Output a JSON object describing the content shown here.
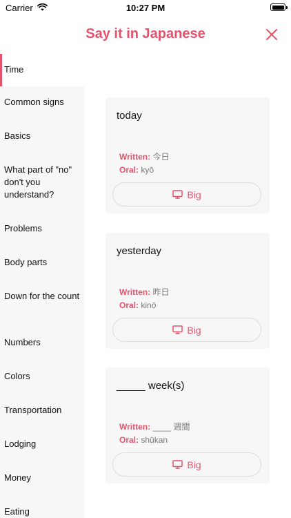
{
  "status_bar": {
    "carrier": "Carrier",
    "time": "10:27 PM"
  },
  "header": {
    "title": "Say it in Japanese"
  },
  "colors": {
    "accent": "#e4536c",
    "sidebar_bg": "#f7f7f7",
    "card_bg": "#f7f7f7"
  },
  "sidebar": {
    "items": [
      {
        "label": "Time",
        "active": true
      },
      {
        "label": "Common signs"
      },
      {
        "label": "Basics"
      },
      {
        "label": "What part of \"no\" don't you understand?"
      },
      {
        "label": "Problems"
      },
      {
        "label": "Body parts"
      },
      {
        "label": "Down for the count"
      },
      {
        "label": "Numbers"
      },
      {
        "label": "Colors"
      },
      {
        "label": "Transportation"
      },
      {
        "label": "Lodging"
      },
      {
        "label": "Money"
      },
      {
        "label": "Eating"
      }
    ]
  },
  "cards": [
    {
      "phrase": "today",
      "written_label": "Written:",
      "written": "今日",
      "oral_label": "Oral:",
      "oral": "kyō",
      "button": "Big"
    },
    {
      "phrase": "yesterday",
      "written_label": "Written:",
      "written": "昨日",
      "oral_label": "Oral:",
      "oral": "kinō",
      "button": "Big"
    },
    {
      "phrase": "_____ week(s)",
      "written_label": "Written:",
      "written": "____ 週間",
      "oral_label": "Oral:",
      "oral": "shūkan",
      "button": "Big"
    }
  ],
  "icons": {
    "close": "close-icon",
    "big": "monitor-icon",
    "wifi": "wifi-icon",
    "battery": "battery-icon"
  }
}
